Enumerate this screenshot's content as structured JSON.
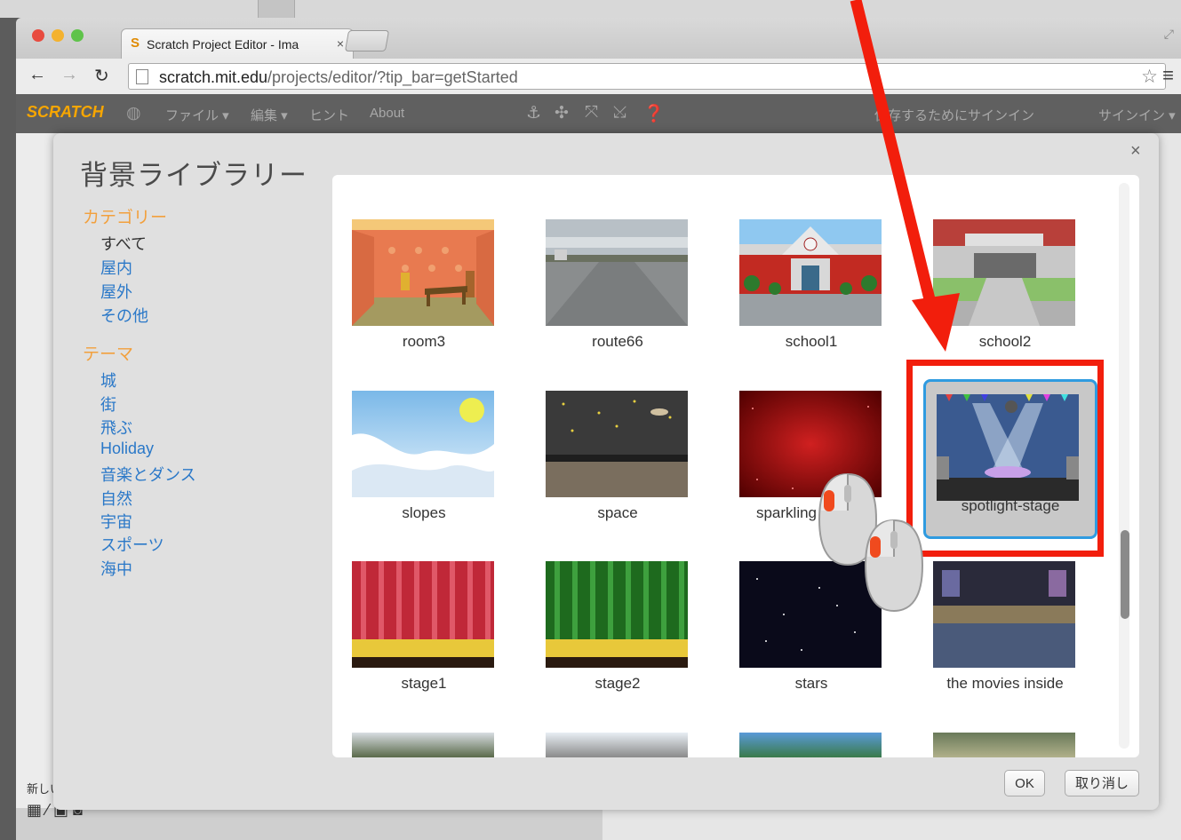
{
  "browser": {
    "tab_title": "Scratch Project Editor - Ima",
    "tab_close": "×",
    "url_host": "scratch.mit.edu",
    "url_path": "/projects/editor/?tip_bar=getStarted"
  },
  "scratch_menu": {
    "logo": "SCRATCH",
    "file": "ファイル ▾",
    "edit": "編集 ▾",
    "tips": "ヒント",
    "about": "About",
    "save_signin": "保存するためにサインイン",
    "signin": "サインイン ▾"
  },
  "editor": {
    "new_backdrop_label": "新しい背景:"
  },
  "dialog": {
    "title": "背景ライブラリー",
    "close": "×",
    "category_heading": "カテゴリー",
    "categories": [
      "すべて",
      "屋内",
      "屋外",
      "その他"
    ],
    "theme_heading": "テーマ",
    "themes": [
      "城",
      "街",
      "飛ぶ",
      "Holiday",
      "音楽とダンス",
      "自然",
      "宇宙",
      "スポーツ",
      "海中"
    ],
    "ok_button": "OK",
    "cancel_button": "取り消し",
    "items": [
      {
        "name": "room3"
      },
      {
        "name": "route66"
      },
      {
        "name": "school1"
      },
      {
        "name": "school2"
      },
      {
        "name": "slopes"
      },
      {
        "name": "space"
      },
      {
        "name": "sparkling"
      },
      {
        "name": "spotlight-stage",
        "selected": true
      },
      {
        "name": "stage1"
      },
      {
        "name": "stage2"
      },
      {
        "name": "stars"
      },
      {
        "name": "the movies inside"
      }
    ]
  },
  "colors": {
    "highlight_box": "#f21e0c",
    "arrow": "#f21e0c",
    "selection_border": "#2f9be0",
    "category_heading": "#f2a03d",
    "category_link": "#2a78c8"
  }
}
